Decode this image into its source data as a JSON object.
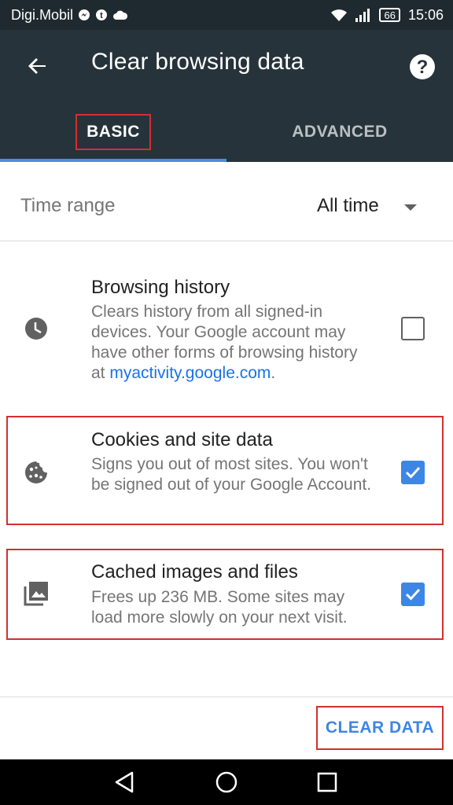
{
  "status_bar": {
    "carrier": "Digi.Mobil",
    "left_icons": [
      "messenger-icon",
      "tumblr-icon",
      "cloud-icon"
    ],
    "right_icons": [
      "wifi-icon",
      "signal-icon"
    ],
    "battery": "66",
    "time": "15:06"
  },
  "app_bar": {
    "title": "Clear browsing data",
    "back_icon": "arrow-back-icon",
    "help_icon": "help-icon"
  },
  "tabs": [
    {
      "label": "BASIC",
      "selected": true
    },
    {
      "label": "ADVANCED",
      "selected": false
    }
  ],
  "time_range": {
    "label": "Time range",
    "value": "All time"
  },
  "items": [
    {
      "title": "Browsing history",
      "desc_text": "Clears history from all signed-in devices. Your Google account may have other forms of browsing history at ",
      "desc_link": "myactivity.google.com",
      "desc_suffix": ".",
      "icon": "clock-icon",
      "checked": false
    },
    {
      "title": "Cookies and site data",
      "desc_text": "Signs you out of most sites. You won't be signed out of your Google Account.",
      "icon": "cookie-icon",
      "checked": true
    },
    {
      "title": "Cached images and files",
      "desc_text": "Frees up 236 MB. Some sites may load more slowly on your next visit.",
      "icon": "images-icon",
      "checked": true
    }
  ],
  "footer": {
    "clear_button": "CLEAR DATA"
  },
  "colors": {
    "toolbar": "#27333a",
    "accent": "#3d86e6",
    "highlight_box": "#d32f2f"
  }
}
